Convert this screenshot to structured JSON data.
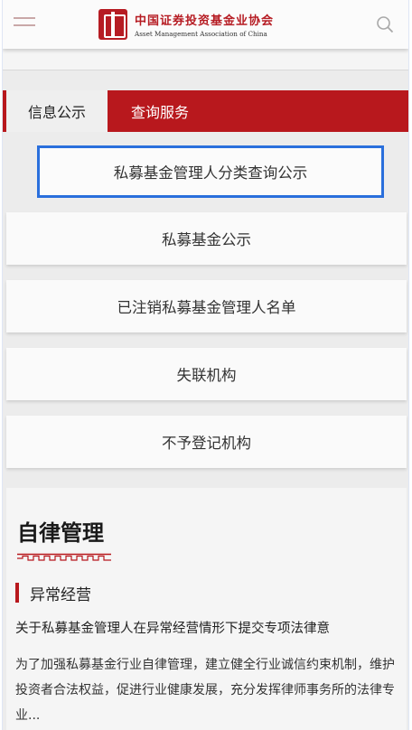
{
  "header": {
    "logo_cn": "中国证券投资基金业协会",
    "logo_en": "Asset Management Association of China",
    "menu_icon": "hamburger-menu-icon",
    "search_icon": "search-icon"
  },
  "tabs": [
    {
      "label": "信息公示",
      "active": true
    },
    {
      "label": "查询服务",
      "active": false
    }
  ],
  "menu_items": [
    {
      "label": "私募基金管理人分类查询公示",
      "selected": true
    },
    {
      "label": "私募基金公示",
      "selected": false
    },
    {
      "label": "已注销私募基金管理人名单",
      "selected": false
    },
    {
      "label": "失联机构",
      "selected": false
    },
    {
      "label": "不予登记机构",
      "selected": false
    }
  ],
  "section": {
    "title": "自律管理",
    "subheading": "异常经营",
    "article_title": "关于私募基金管理人在异常经营情形下提交专项法律意",
    "article_body": "为了加强私募基金行业自律管理，建立健全行业诚信约束机制，维护投资者合法权益，促进行业健康发展，充分发挥律师事务所的法律专业..."
  },
  "colors": {
    "brand_red": "#b8181d",
    "selection_blue": "#2a6fdc"
  }
}
